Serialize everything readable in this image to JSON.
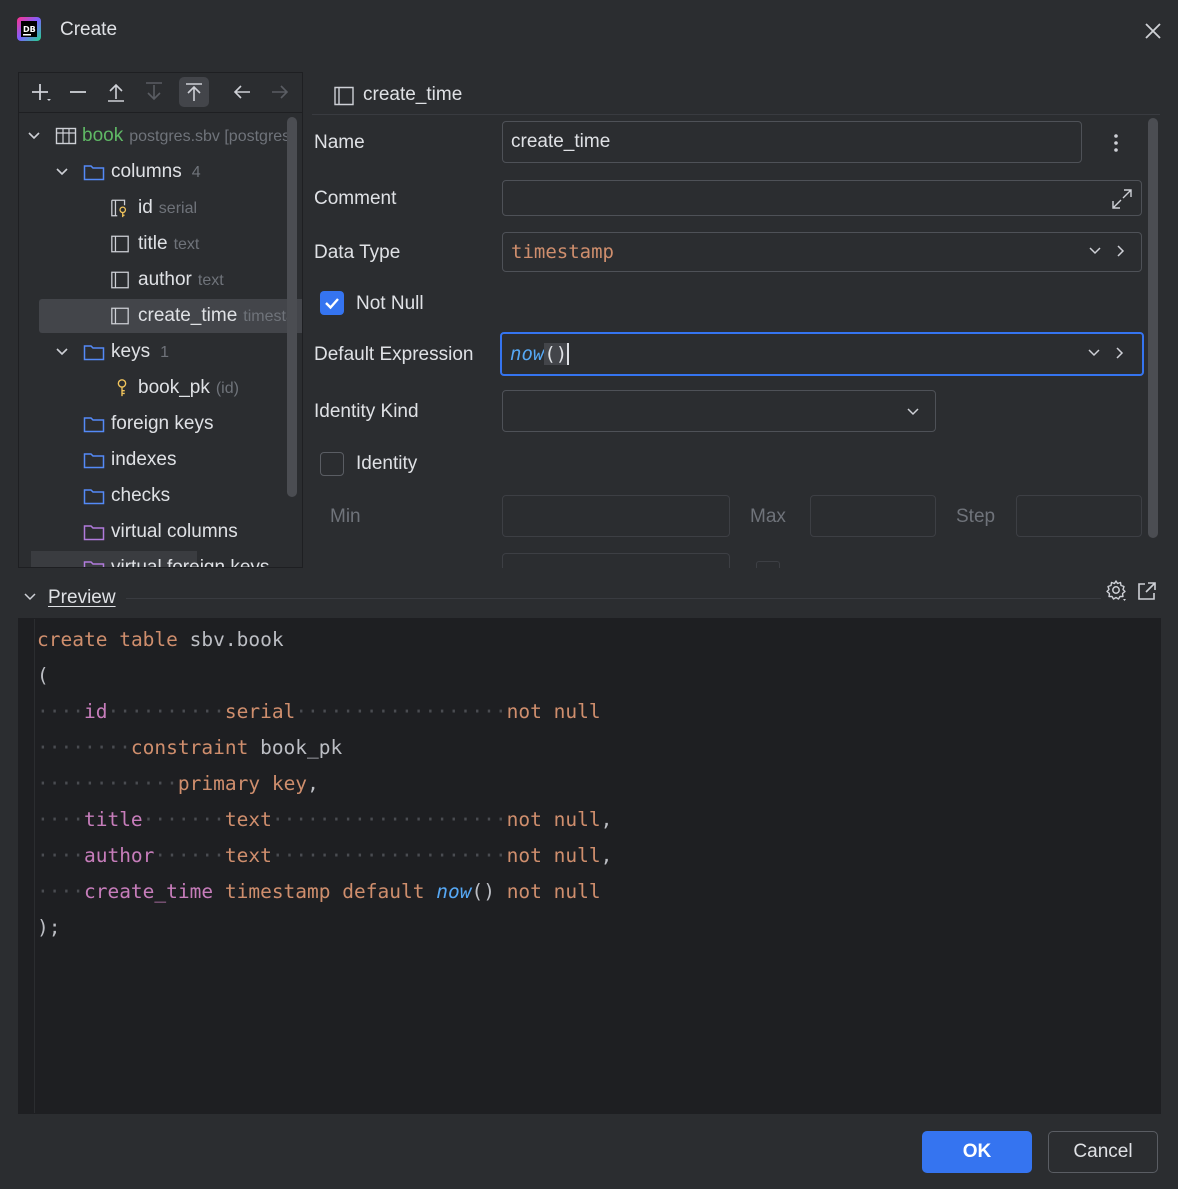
{
  "window": {
    "title": "Create"
  },
  "tree": {
    "toolbar": [
      "add-icon",
      "remove-icon",
      "move-up-icon",
      "move-down-icon",
      "move-top-icon",
      "back-icon",
      "forward-icon"
    ],
    "table": {
      "name": "book",
      "sub": "postgres.sbv [postgres"
    },
    "columns_folder": {
      "label": "columns",
      "count": "4"
    },
    "columns": [
      {
        "name": "id",
        "type": "serial"
      },
      {
        "name": "title",
        "type": "text"
      },
      {
        "name": "author",
        "type": "text"
      },
      {
        "name": "create_time",
        "type": "timesta"
      }
    ],
    "keys_folder": {
      "label": "keys",
      "count": "1"
    },
    "key": {
      "name": "book_pk",
      "sub": "(id)"
    },
    "folders": [
      "foreign keys",
      "indexes",
      "checks",
      "virtual columns",
      "virtual foreign keys"
    ]
  },
  "props": {
    "header": "create_time",
    "name_label": "Name",
    "name_value": "create_time",
    "comment_label": "Comment",
    "comment_value": "",
    "datatype_label": "Data Type",
    "datatype_value": "timestamp",
    "notnull_label": "Not Null",
    "notnull_checked": true,
    "default_label": "Default Expression",
    "default_fn": "now",
    "default_parens": "()",
    "identity_kind_label": "Identity Kind",
    "identity_kind_value": "",
    "identity_label": "Identity",
    "identity_checked": false,
    "min_label": "Min",
    "max_label": "Max",
    "step_label": "Step"
  },
  "preview": {
    "label": "Preview",
    "code": [
      "create table sbv.book",
      "(",
      "id serial not null",
      "constraint book_pk",
      "primary key,",
      "title text not null,",
      "author text not null,",
      "create_time timestamp default now() not null",
      ");"
    ]
  },
  "buttons": {
    "ok": "OK",
    "cancel": "Cancel"
  },
  "colors": {
    "accent": "#3574f0",
    "background": "#2b2d30",
    "editor_bg": "#1e1f22",
    "keyword": "#cf8e6d",
    "identifier": "#c77dbb",
    "function": "#56a8f5",
    "table_name": "#5fb865"
  }
}
